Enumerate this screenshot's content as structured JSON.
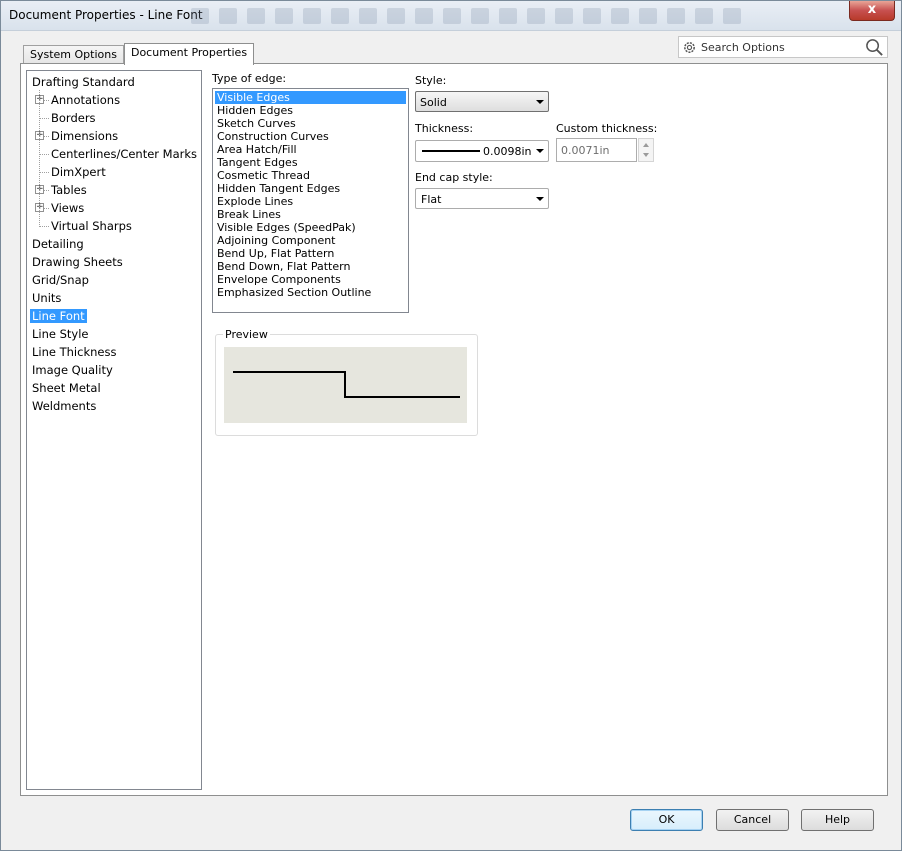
{
  "window": {
    "title": "Document Properties - Line Font",
    "close_glyph": "x"
  },
  "tabs": [
    {
      "label": "System Options",
      "active": false
    },
    {
      "label": "Document Properties",
      "active": true
    }
  ],
  "search": {
    "placeholder": "Search Options",
    "icon": "magnifier-icon",
    "settings_icon": "gear-icon"
  },
  "tree": {
    "items": [
      {
        "label": "Drafting Standard",
        "level": 0,
        "expander": false,
        "selected": false
      },
      {
        "label": "Annotations",
        "level": 1,
        "expander": true,
        "selected": false
      },
      {
        "label": "Borders",
        "level": 1,
        "expander": false,
        "selected": false
      },
      {
        "label": "Dimensions",
        "level": 1,
        "expander": true,
        "selected": false
      },
      {
        "label": "Centerlines/Center Marks",
        "level": 1,
        "expander": false,
        "selected": false
      },
      {
        "label": "DimXpert",
        "level": 1,
        "expander": false,
        "selected": false
      },
      {
        "label": "Tables",
        "level": 1,
        "expander": true,
        "selected": false
      },
      {
        "label": "Views",
        "level": 1,
        "expander": true,
        "selected": false
      },
      {
        "label": "Virtual Sharps",
        "level": 1,
        "expander": false,
        "selected": false
      },
      {
        "label": "Detailing",
        "level": 0,
        "expander": false,
        "selected": false
      },
      {
        "label": "Drawing Sheets",
        "level": 0,
        "expander": false,
        "selected": false
      },
      {
        "label": "Grid/Snap",
        "level": 0,
        "expander": false,
        "selected": false
      },
      {
        "label": "Units",
        "level": 0,
        "expander": false,
        "selected": false
      },
      {
        "label": "Line Font",
        "level": 0,
        "expander": false,
        "selected": true
      },
      {
        "label": "Line Style",
        "level": 0,
        "expander": false,
        "selected": false
      },
      {
        "label": "Line Thickness",
        "level": 0,
        "expander": false,
        "selected": false
      },
      {
        "label": "Image Quality",
        "level": 0,
        "expander": false,
        "selected": false
      },
      {
        "label": "Sheet Metal",
        "level": 0,
        "expander": false,
        "selected": false
      },
      {
        "label": "Weldments",
        "level": 0,
        "expander": false,
        "selected": false
      }
    ]
  },
  "edge": {
    "label": "Type of edge:",
    "items": [
      {
        "label": "Visible Edges",
        "selected": true
      },
      {
        "label": "Hidden Edges",
        "selected": false
      },
      {
        "label": "Sketch Curves",
        "selected": false
      },
      {
        "label": "Construction Curves",
        "selected": false
      },
      {
        "label": "Area Hatch/Fill",
        "selected": false
      },
      {
        "label": "Tangent Edges",
        "selected": false
      },
      {
        "label": "Cosmetic Thread",
        "selected": false
      },
      {
        "label": "Hidden Tangent Edges",
        "selected": false
      },
      {
        "label": "Explode Lines",
        "selected": false
      },
      {
        "label": "Break Lines",
        "selected": false
      },
      {
        "label": "Visible Edges (SpeedPak)",
        "selected": false
      },
      {
        "label": "Adjoining Component",
        "selected": false
      },
      {
        "label": "Bend Up, Flat Pattern",
        "selected": false
      },
      {
        "label": "Bend Down, Flat Pattern",
        "selected": false
      },
      {
        "label": "Envelope Components",
        "selected": false
      },
      {
        "label": "Emphasized Section Outline",
        "selected": false
      }
    ]
  },
  "style": {
    "label": "Style:",
    "value": "Solid"
  },
  "thickness": {
    "label": "Thickness:",
    "value": "0.0098in"
  },
  "custom_thickness": {
    "label": "Custom thickness:",
    "value": "0.0071in"
  },
  "end_cap": {
    "label": "End cap style:",
    "value": "Flat"
  },
  "preview": {
    "label": "Preview"
  },
  "buttons": {
    "ok": "OK",
    "cancel": "Cancel",
    "help": "Help"
  }
}
